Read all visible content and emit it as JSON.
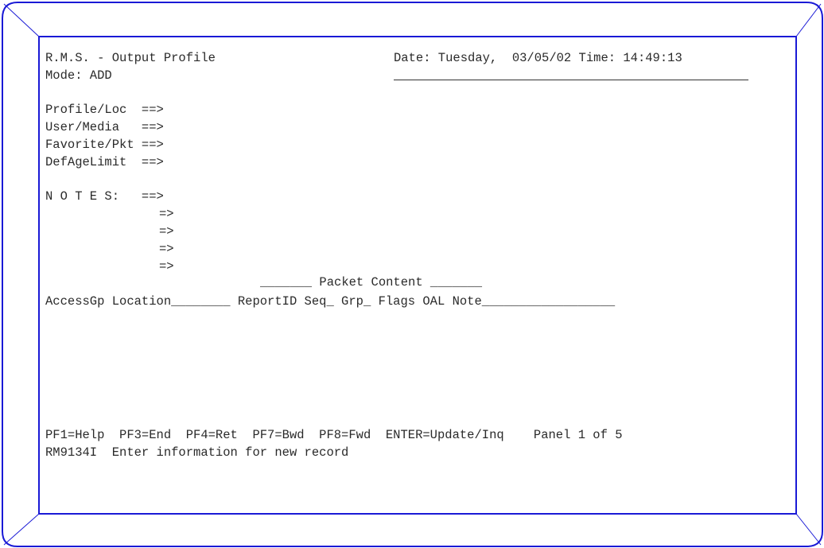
{
  "header": {
    "title": "R.M.S. - Output Profile",
    "date": "Date: Tuesday,  03/05/02 Time: 14:49:13",
    "mode": "Mode: ADD"
  },
  "fields": {
    "profile_loc": "Profile/Loc  ==>",
    "user_media": "User/Media   ==>",
    "favorite_pkt": "Favorite/Pkt ==>",
    "def_age_limit": "DefAgeLimit  ==>",
    "notes": "N O T E S:   ==>",
    "notes_cont": "=>"
  },
  "packet": {
    "title_line": "_______ Packet Content _______",
    "columns_line": "AccessGp Location________ ReportID Seq_ Grp_ Flags OAL Note__________________"
  },
  "footer": {
    "keys": "PF1=Help  PF3=End  PF4=Ret  PF7=Bwd  PF8=Fwd  ENTER=Update/Inq    Panel 1 of 5",
    "message": "RM9134I  Enter information for new record"
  },
  "colors": {
    "frame": "#1a1ad6",
    "text": "#2a2a2a",
    "background": "#ffffff"
  }
}
